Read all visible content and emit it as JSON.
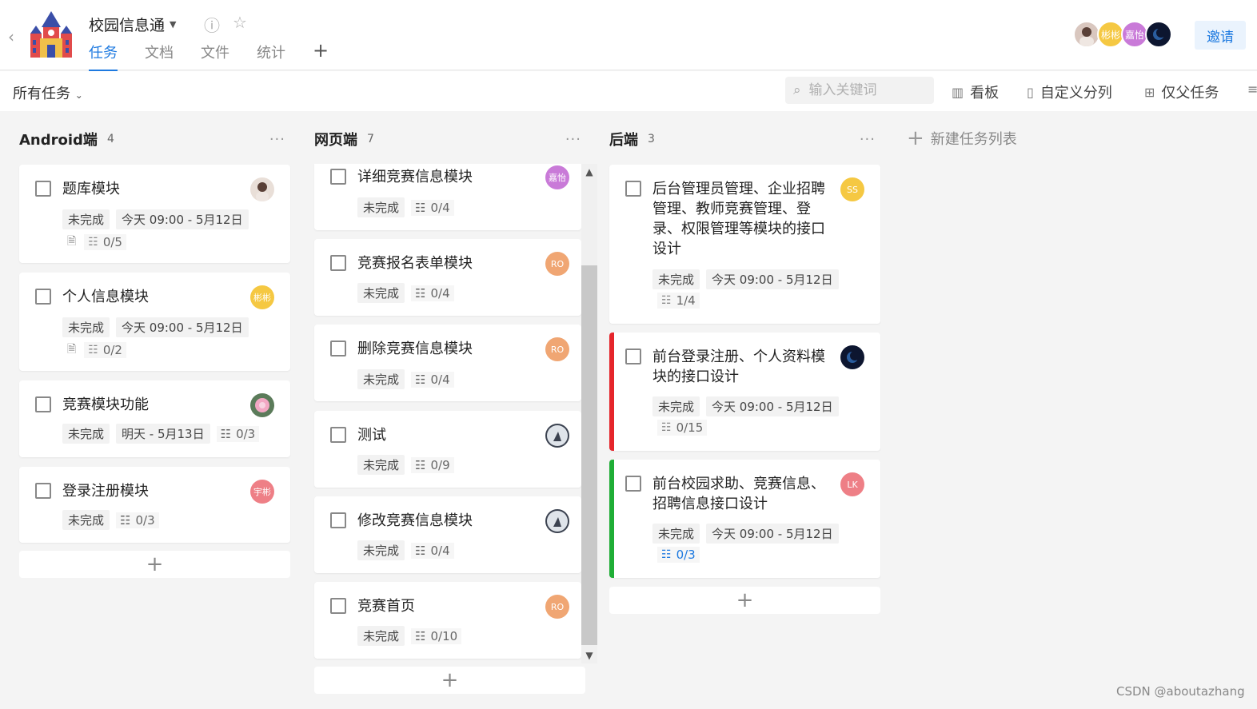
{
  "header": {
    "project_name": "校园信息通",
    "tabs": [
      {
        "label": "任务",
        "active": true
      },
      {
        "label": "文档",
        "active": false
      },
      {
        "label": "文件",
        "active": false
      },
      {
        "label": "统计",
        "active": false
      }
    ],
    "members": [
      "彬彬",
      "嘉怡"
    ],
    "invite_label": "邀请"
  },
  "toolbar": {
    "filter_label": "所有任务",
    "search_placeholder": "输入关键词",
    "board_label": "看板",
    "custom_group_label": "自定义分列",
    "parent_only_label": "仅父任务"
  },
  "columns": [
    {
      "title": "Android端",
      "count": "4",
      "cards": [
        {
          "title": "题库模块",
          "status": "未完成",
          "date": "今天 09:00 - 5月12日",
          "subtasks": "0/5"
        },
        {
          "title": "个人信息模块",
          "status": "未完成",
          "date": "今天 09:00 - 5月12日",
          "subtasks": "0/2",
          "avatar": "彬彬"
        },
        {
          "title": "竞赛模块功能",
          "status": "未完成",
          "date": "明天 - 5月13日",
          "subtasks": "0/3"
        },
        {
          "title": "登录注册模块",
          "status": "未完成",
          "subtasks": "0/3",
          "avatar": "宇彬"
        }
      ]
    },
    {
      "title": "网页端",
      "count": "7",
      "cards": [
        {
          "title": "详细竞赛信息模块",
          "status": "未完成",
          "subtasks": "0/4",
          "avatar": "嘉怡"
        },
        {
          "title": "竞赛报名表单模块",
          "status": "未完成",
          "subtasks": "0/4",
          "avatar": "RO"
        },
        {
          "title": "删除竞赛信息模块",
          "status": "未完成",
          "subtasks": "0/4",
          "avatar": "RO"
        },
        {
          "title": "测试",
          "status": "未完成",
          "subtasks": "0/9"
        },
        {
          "title": "修改竞赛信息模块",
          "status": "未完成",
          "subtasks": "0/4"
        },
        {
          "title": "竞赛首页",
          "status": "未完成",
          "subtasks": "0/10",
          "avatar": "RO"
        }
      ]
    },
    {
      "title": "后端",
      "count": "3",
      "cards": [
        {
          "title_lines": [
            "后台管理员管理、企业招聘",
            "管理、教师竞赛管理、登",
            "录、权限管理等模块的接口",
            "设计"
          ],
          "status": "未完成",
          "date": "今天 09:00 - 5月12日",
          "subtasks": "1/4",
          "avatar": "SS"
        },
        {
          "title_lines": [
            "前台登录注册、个人资料模",
            "块的接口设计"
          ],
          "status": "未完成",
          "date": "今天 09:00 - 5月12日",
          "subtasks": "0/15"
        },
        {
          "title_lines": [
            "前台校园求助、竞赛信息、",
            "招聘信息接口设计"
          ],
          "status": "未完成",
          "date": "今天 09:00 - 5月12日",
          "subtasks": "0/3",
          "avatar": "LK"
        }
      ]
    }
  ],
  "new_list_label": "新建任务列表",
  "watermark": "CSDN @aboutazhang",
  "colors": {
    "accent": "#1e7ae0",
    "flag_red": "#e5252b",
    "flag_green": "#1fae36",
    "avatar_yellow": "#f5c842",
    "avatar_purple": "#c97ad8",
    "avatar_orange": "#f0a673",
    "avatar_pink": "#ee7f86"
  }
}
